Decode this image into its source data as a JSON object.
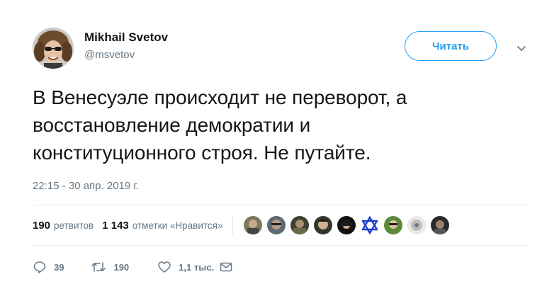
{
  "author": {
    "name": "Mikhail Svetov",
    "handle": "@msvetov"
  },
  "follow_button_label": "Читать",
  "tweet": {
    "lines": [
      "В Венесуэле происходит не переворот, а",
      "восстановление демократии и",
      "конституционного строя. Не путайте."
    ],
    "timestamp": "22:15 - 30 апр. 2019 г."
  },
  "stats": {
    "retweets_count": "190",
    "retweets_label": "ретвитов",
    "likes_count": "1 143",
    "likes_label": "отметки «Нравится»"
  },
  "actions": {
    "replies": "39",
    "retweets": "190",
    "likes": "1,1 тыс."
  },
  "colors": {
    "accent": "#1da1f2",
    "secondary_text": "#657786",
    "divider": "#e6ecf0"
  },
  "icons": [
    "chevron-down-icon",
    "reply-icon",
    "retweet-icon",
    "heart-icon",
    "envelope-icon",
    "star-of-david-icon"
  ]
}
